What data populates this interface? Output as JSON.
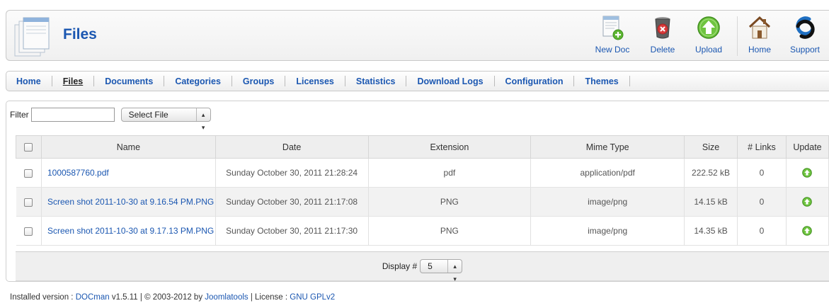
{
  "header": {
    "title": "Files",
    "buttons": {
      "new_doc": "New Doc",
      "delete": "Delete",
      "upload": "Upload",
      "home": "Home",
      "support": "Support"
    }
  },
  "submenu": {
    "items": [
      "Home",
      "Files",
      "Documents",
      "Categories",
      "Groups",
      "Licenses",
      "Statistics",
      "Download Logs",
      "Configuration",
      "Themes"
    ],
    "active": "Files"
  },
  "filter": {
    "label": "Filter",
    "value": "",
    "select_value": "Select File"
  },
  "table": {
    "columns": [
      "Name",
      "Date",
      "Extension",
      "Mime Type",
      "Size",
      "# Links",
      "Update"
    ],
    "rows": [
      {
        "name": "1000587760.pdf",
        "date": "Sunday October 30, 2011 21:28:24",
        "extension": "pdf",
        "mime": "application/pdf",
        "size": "222.52 kB",
        "links": "0"
      },
      {
        "name": "Screen shot 2011-10-30 at 9.16.54 PM.PNG",
        "date": "Sunday October 30, 2011 21:17:08",
        "extension": "PNG",
        "mime": "image/png",
        "size": "14.15 kB",
        "links": "0"
      },
      {
        "name": "Screen shot 2011-10-30 at 9.17.13 PM.PNG",
        "date": "Sunday October 30, 2011 21:17:30",
        "extension": "PNG",
        "mime": "image/png",
        "size": "14.35 kB",
        "links": "0"
      }
    ]
  },
  "pager": {
    "label": "Display #",
    "value": "5"
  },
  "footer": {
    "prefix": "Installed version : ",
    "product": "DOCman",
    "version": " v1.5.11 | © 2003-2012 by ",
    "vendor": "Joomlatools",
    "license_label": " | License : ",
    "license": "GNU GPLv2"
  },
  "colors": {
    "link": "#1b57b1",
    "upload_green": "#5cb531",
    "delete_red": "#d83a3a",
    "support_blue": "#1f6fc2"
  }
}
